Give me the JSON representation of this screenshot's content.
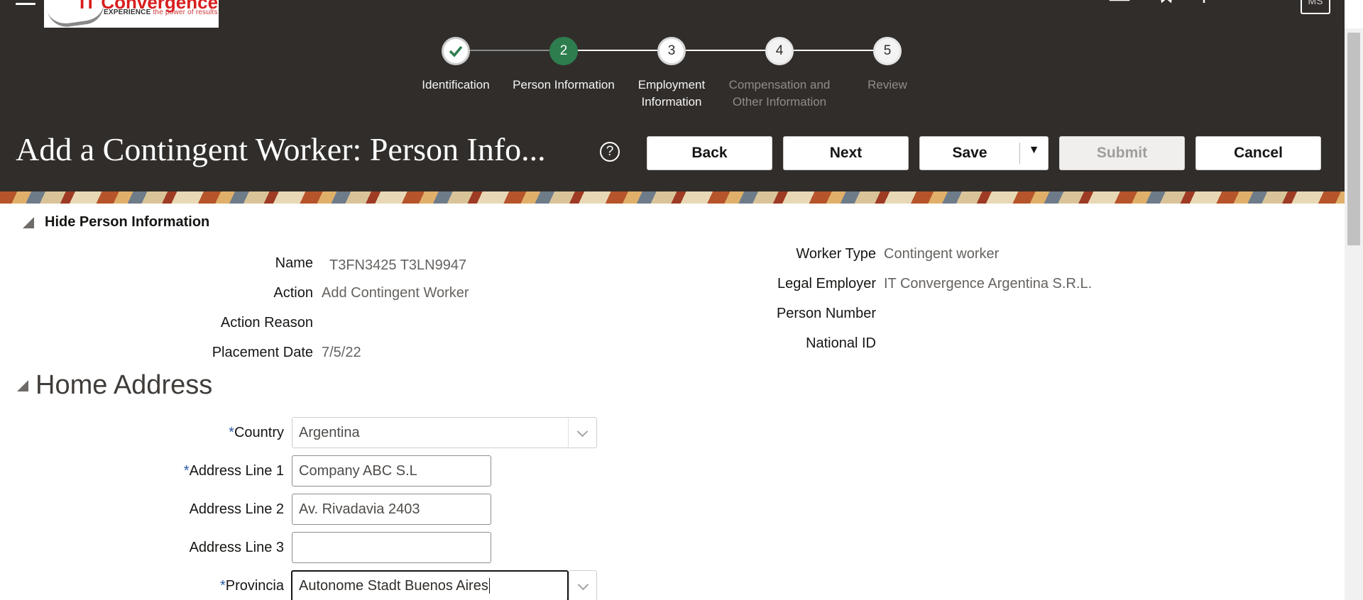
{
  "header": {
    "logo_brand": "IT Convergence",
    "logo_tagline_1": "EXPERIENCE",
    "logo_tagline_2": "the power of results",
    "avatar_initials": "MS",
    "page_title": "Add a Contingent Worker: Person Info...",
    "help": "?",
    "buttons": {
      "back": "Back",
      "next": "Next",
      "save": "Save",
      "submit": "Submit",
      "cancel": "Cancel"
    }
  },
  "train": {
    "steps": [
      {
        "number": "✓",
        "label": "Identification",
        "state": "visited"
      },
      {
        "number": "2",
        "label": "Person Information",
        "state": "current"
      },
      {
        "number": "3",
        "label": "Employment Information",
        "state": "unvisited"
      },
      {
        "number": "4",
        "label": "Compensation and Other Information",
        "state": "disabled"
      },
      {
        "number": "5",
        "label": "Review",
        "state": "disabled"
      }
    ]
  },
  "person_info": {
    "toggle_label": "Hide Person Information",
    "left": [
      {
        "label": "Name",
        "value": "T3FN3425 T3LN9947"
      },
      {
        "label": "Action",
        "value": "Add Contingent Worker"
      },
      {
        "label": "Action Reason",
        "value": ""
      },
      {
        "label": "Placement Date",
        "value": "7/5/22"
      }
    ],
    "right": [
      {
        "label": "Worker Type",
        "value": "Contingent worker"
      },
      {
        "label": "Legal Employer",
        "value": "IT Convergence Argentina S.R.L."
      },
      {
        "label": "Person Number",
        "value": ""
      },
      {
        "label": "National ID",
        "value": ""
      }
    ]
  },
  "home_address": {
    "title": "Home Address",
    "required_marker": "*",
    "fields": {
      "country": {
        "label": "Country",
        "value": "Argentina"
      },
      "address_line_1": {
        "label": "Address Line 1",
        "value": "Company ABC S.L"
      },
      "address_line_2": {
        "label": "Address Line 2",
        "value": "Av. Rivadavia 2403"
      },
      "address_line_3": {
        "label": "Address Line 3",
        "value": ""
      },
      "provincia": {
        "label": "Provincia",
        "value": "Autonome Stadt Buenos Aires"
      }
    }
  },
  "colors": {
    "header_bg": "#312d2a",
    "current_step": "#2e7d4f",
    "required_star": "#2b5aa6"
  }
}
